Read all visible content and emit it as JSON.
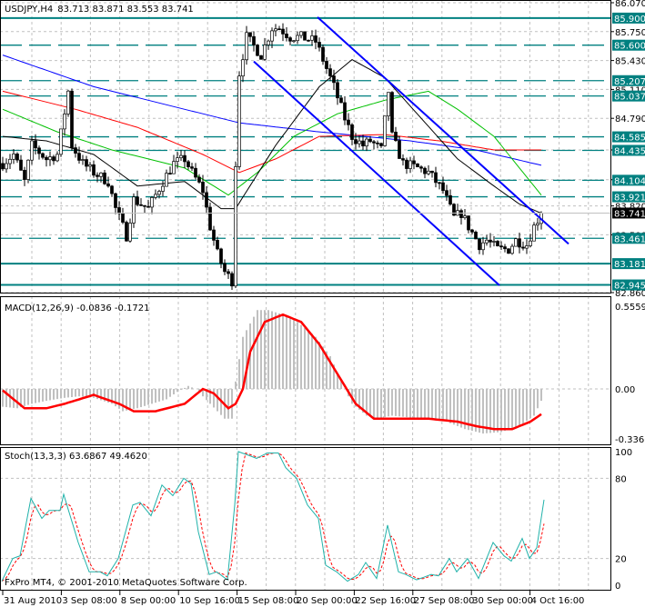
{
  "header": {
    "symbol": "USDJPY,H4",
    "ohlc": "83.713 83.871 83.553 83.741"
  },
  "macd_label": "MACD(12,26,9) -0.0836 -0.1721",
  "stoch_label": "Stoch(13,3,3) 63.6867 49.4620",
  "copyright": "FxPro MT4, © 2001-2010 MetaQuotes Software Corp.",
  "colors": {
    "level": "#008080",
    "trendline": "#0000ff",
    "bull": "#ffffff",
    "bear": "#000000",
    "macd_hist": "#c0c0c0",
    "macd_signal": "#ff0000",
    "stoch_main": "#20b2aa",
    "stoch_signal": "#ff0000"
  },
  "chart_data": [
    {
      "type": "candlestick",
      "title": "USDJPY,H4",
      "ylim": [
        82.86,
        86.07
      ],
      "y_ticks": [
        "86.070",
        "85.750",
        "85.430",
        "85.110",
        "84.790",
        "84.440",
        "84.110",
        "83.820",
        "83.500",
        "82.860"
      ],
      "x_ticks": [
        "31 Aug 2010",
        "3 Sep 08:00",
        "8 Sep 00:00",
        "10 Sep 16:00",
        "15 Sep 08:00",
        "20 Sep 00:00",
        "22 Sep 16:00",
        "27 Sep 08:00",
        "30 Sep 00:00",
        "4 Oct 16:00"
      ],
      "current_price": "83.741",
      "levels": [
        {
          "price": "85.900",
          "style": "solid"
        },
        {
          "price": "85.600",
          "style": "dashed"
        },
        {
          "price": "85.207",
          "style": "dashed"
        },
        {
          "price": "85.037",
          "style": "dashed"
        },
        {
          "price": "84.585",
          "style": "dashed"
        },
        {
          "price": "84.435",
          "style": "dashed"
        },
        {
          "price": "84.104",
          "style": "dashed"
        },
        {
          "price": "83.921",
          "style": "dashed"
        },
        {
          "price": "83.461",
          "style": "dashed"
        },
        {
          "price": "83.181",
          "style": "solid"
        },
        {
          "price": "82.945",
          "style": "solid"
        }
      ],
      "close_path_bar_price": [
        [
          0,
          84.29
        ],
        [
          3,
          84.39
        ],
        [
          6,
          84.09
        ],
        [
          8,
          84.49
        ],
        [
          12,
          84.34
        ],
        [
          15,
          84.39
        ],
        [
          18,
          85.09
        ],
        [
          19,
          84.49
        ],
        [
          22,
          84.29
        ],
        [
          25,
          84.19
        ],
        [
          29,
          84.09
        ],
        [
          31,
          83.79
        ],
        [
          34,
          83.49
        ],
        [
          36,
          83.89
        ],
        [
          40,
          83.79
        ],
        [
          44,
          84.09
        ],
        [
          47,
          84.29
        ],
        [
          50,
          84.34
        ],
        [
          52,
          84.19
        ],
        [
          55,
          83.99
        ],
        [
          57,
          83.59
        ],
        [
          59,
          83.29
        ],
        [
          61,
          83.09
        ],
        [
          63,
          82.99
        ],
        [
          64,
          84.29
        ],
        [
          65,
          85.29
        ],
        [
          67,
          85.69
        ],
        [
          69,
          85.59
        ],
        [
          71,
          85.49
        ],
        [
          74,
          85.79
        ],
        [
          76,
          85.79
        ],
        [
          79,
          85.69
        ],
        [
          82,
          85.69
        ],
        [
          86,
          85.64
        ],
        [
          89,
          85.34
        ],
        [
          91,
          85.14
        ],
        [
          94,
          84.79
        ],
        [
          96,
          84.59
        ],
        [
          99,
          84.49
        ],
        [
          101,
          84.54
        ],
        [
          104,
          84.44
        ],
        [
          106,
          85.09
        ],
        [
          107,
          84.59
        ],
        [
          110,
          84.29
        ],
        [
          114,
          84.24
        ],
        [
          117,
          84.19
        ],
        [
          121,
          83.99
        ],
        [
          124,
          83.69
        ],
        [
          126,
          83.74
        ],
        [
          128,
          83.59
        ],
        [
          131,
          83.39
        ],
        [
          133,
          83.44
        ],
        [
          136,
          83.34
        ],
        [
          139,
          83.34
        ],
        [
          141,
          83.44
        ],
        [
          144,
          83.39
        ],
        [
          146,
          83.59
        ],
        [
          148,
          83.741
        ]
      ],
      "moving_averages": [
        {
          "color": "#0000ff",
          "points": [
            [
              0,
              85.49
            ],
            [
              25,
              85.14
            ],
            [
              50,
              84.89
            ],
            [
              65,
              84.74
            ],
            [
              87,
              84.64
            ],
            [
              112,
              84.54
            ],
            [
              130,
              84.44
            ],
            [
              148,
              84.27
            ]
          ]
        },
        {
          "color": "#ff0000",
          "points": [
            [
              0,
              85.09
            ],
            [
              20,
              84.89
            ],
            [
              37,
              84.69
            ],
            [
              55,
              84.39
            ],
            [
              65,
              84.19
            ],
            [
              75,
              84.34
            ],
            [
              87,
              84.59
            ],
            [
              105,
              84.61
            ],
            [
              120,
              84.54
            ],
            [
              135,
              84.44
            ],
            [
              148,
              84.44
            ]
          ]
        },
        {
          "color": "#00c000",
          "points": [
            [
              0,
              84.89
            ],
            [
              15,
              84.64
            ],
            [
              30,
              84.44
            ],
            [
              50,
              84.24
            ],
            [
              62,
              83.94
            ],
            [
              70,
              84.19
            ],
            [
              80,
              84.59
            ],
            [
              92,
              84.84
            ],
            [
              105,
              84.99
            ],
            [
              117,
              85.09
            ],
            [
              125,
              84.89
            ],
            [
              135,
              84.59
            ],
            [
              142,
              84.24
            ],
            [
              148,
              83.94
            ]
          ]
        },
        {
          "color": "#000000",
          "points": [
            [
              0,
              84.59
            ],
            [
              12,
              84.54
            ],
            [
              25,
              84.39
            ],
            [
              37,
              84.04
            ],
            [
              50,
              84.09
            ],
            [
              60,
              83.79
            ],
            [
              64,
              83.79
            ],
            [
              75,
              84.49
            ],
            [
              87,
              85.14
            ],
            [
              96,
              85.44
            ],
            [
              105,
              85.24
            ],
            [
              115,
              84.79
            ],
            [
              125,
              84.34
            ],
            [
              135,
              84.04
            ],
            [
              142,
              83.84
            ],
            [
              148,
              83.74
            ]
          ]
        }
      ],
      "trendlines": [
        [
          [
            86.5,
            85.91
          ],
          [
            155.5,
            83.4
          ]
        ],
        [
          [
            69,
            85.42
          ],
          [
            136.5,
            82.94
          ]
        ]
      ]
    },
    {
      "type": "bar+line",
      "title": "MACD(12,26,9)",
      "ylim": [
        -0.3366,
        0.5559
      ],
      "y_ticks": [
        "0.5559",
        "0.00",
        "-0.3366"
      ],
      "histogram": [
        [
          0,
          -0.12
        ],
        [
          4,
          -0.13
        ],
        [
          8,
          -0.1
        ],
        [
          12,
          -0.08
        ],
        [
          17,
          -0.06
        ],
        [
          21,
          -0.05
        ],
        [
          25,
          -0.06
        ],
        [
          30,
          -0.1
        ],
        [
          33,
          -0.15
        ],
        [
          37,
          -0.13
        ],
        [
          41,
          -0.1
        ],
        [
          45,
          -0.07
        ],
        [
          48,
          -0.02
        ],
        [
          51,
          0.02
        ],
        [
          53,
          0.0
        ],
        [
          57,
          -0.1
        ],
        [
          61,
          -0.2
        ],
        [
          63,
          -0.2
        ],
        [
          64,
          0.05
        ],
        [
          66,
          0.35
        ],
        [
          70,
          0.53
        ],
        [
          73,
          0.53
        ],
        [
          77,
          0.5
        ],
        [
          81,
          0.45
        ],
        [
          86,
          0.35
        ],
        [
          90,
          0.22
        ],
        [
          93,
          0.05
        ],
        [
          96,
          -0.1
        ],
        [
          100,
          -0.18
        ],
        [
          103,
          -0.2
        ],
        [
          107,
          -0.18
        ],
        [
          115,
          -0.2
        ],
        [
          122,
          -0.22
        ],
        [
          127,
          -0.27
        ],
        [
          132,
          -0.3
        ],
        [
          137,
          -0.29
        ],
        [
          142,
          -0.25
        ],
        [
          146,
          -0.18
        ],
        [
          148,
          -0.08
        ]
      ],
      "signal": [
        [
          0,
          -0.01
        ],
        [
          6,
          -0.13
        ],
        [
          12,
          -0.13
        ],
        [
          17,
          -0.1
        ],
        [
          25,
          -0.04
        ],
        [
          32,
          -0.1
        ],
        [
          36,
          -0.15
        ],
        [
          42,
          -0.15
        ],
        [
          50,
          -0.1
        ],
        [
          55,
          0.0
        ],
        [
          58,
          -0.03
        ],
        [
          62,
          -0.13
        ],
        [
          64,
          -0.1
        ],
        [
          66,
          0.0
        ],
        [
          68,
          0.25
        ],
        [
          72,
          0.45
        ],
        [
          77,
          0.5
        ],
        [
          82,
          0.45
        ],
        [
          87,
          0.3
        ],
        [
          92,
          0.1
        ],
        [
          97,
          -0.1
        ],
        [
          102,
          -0.2
        ],
        [
          110,
          -0.2
        ],
        [
          117,
          -0.2
        ],
        [
          125,
          -0.22
        ],
        [
          130,
          -0.25
        ],
        [
          135,
          -0.27
        ],
        [
          140,
          -0.27
        ],
        [
          145,
          -0.22
        ],
        [
          148,
          -0.17
        ]
      ]
    },
    {
      "type": "line",
      "title": "Stoch(13,3,3)",
      "ylim": [
        0,
        100
      ],
      "y_ticks": [
        "100",
        "80",
        "20",
        "0"
      ],
      "main": [
        [
          0,
          3
        ],
        [
          3,
          20
        ],
        [
          5,
          22
        ],
        [
          8,
          65
        ],
        [
          11,
          50
        ],
        [
          13,
          56
        ],
        [
          16,
          56
        ],
        [
          17,
          68
        ],
        [
          21,
          32
        ],
        [
          24,
          10
        ],
        [
          27,
          10
        ],
        [
          29,
          7
        ],
        [
          32,
          20
        ],
        [
          36,
          60
        ],
        [
          38,
          62
        ],
        [
          41,
          52
        ],
        [
          44,
          75
        ],
        [
          47,
          67
        ],
        [
          50,
          80
        ],
        [
          52,
          76
        ],
        [
          54,
          40
        ],
        [
          57,
          8
        ],
        [
          59,
          10
        ],
        [
          62,
          4
        ],
        [
          64,
          60
        ],
        [
          65,
          100
        ],
        [
          67,
          98
        ],
        [
          70,
          95
        ],
        [
          73,
          99
        ],
        [
          76,
          99
        ],
        [
          78,
          88
        ],
        [
          81,
          80
        ],
        [
          84,
          60
        ],
        [
          87,
          50
        ],
        [
          89,
          15
        ],
        [
          92,
          10
        ],
        [
          95,
          3
        ],
        [
          98,
          8
        ],
        [
          100,
          17
        ],
        [
          103,
          5
        ],
        [
          106,
          45
        ],
        [
          109,
          10
        ],
        [
          111,
          8
        ],
        [
          114,
          4
        ],
        [
          118,
          8
        ],
        [
          120,
          7
        ],
        [
          123,
          20
        ],
        [
          125,
          10
        ],
        [
          128,
          20
        ],
        [
          131,
          5
        ],
        [
          135,
          32
        ],
        [
          138,
          22
        ],
        [
          140,
          18
        ],
        [
          143,
          35
        ],
        [
          145,
          20
        ],
        [
          147,
          28
        ],
        [
          149,
          64
        ]
      ]
    }
  ]
}
